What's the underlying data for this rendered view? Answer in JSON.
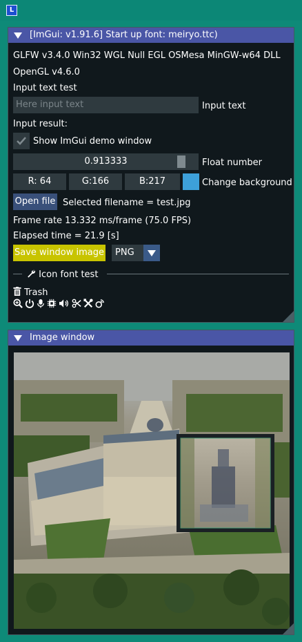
{
  "window": {
    "app_icon_letter": "L"
  },
  "main_panel": {
    "title": "[ImGui: v1.91.6] Start up font: meiryo.ttc)",
    "info_line1": "GLFW v3.4.0 Win32 WGL Null EGL OSMesa MinGW-w64 DLL",
    "info_line2": "OpenGL v4.6.0",
    "input_label": "Input text test",
    "input_placeholder": "Here input text",
    "input_side_label": "Input text",
    "input_result_label": "Input result:",
    "checkbox_label": "Show ImGui demo window",
    "checkbox_checked": true,
    "float_value": "0.913333",
    "float_label": "Float number",
    "float_fraction": 0.913333,
    "rgb": {
      "r": "R: 64",
      "g": "G:166",
      "b": "B:217"
    },
    "bg_label": "Change background",
    "bg_color": "#3da0d9",
    "open_file_label": "Open file",
    "selected_filename": "Selected filename = test.jpg",
    "frame_rate": "Frame rate  13.332 ms/frame (75.0 FPS)",
    "elapsed": "Elapsed time = 21.9 [s]",
    "save_label": "Save window image",
    "format_value": "PNG",
    "icon_section_label": "Icon font test",
    "trash_label": "Trash",
    "icon_names": [
      "search-plus-icon",
      "power-icon",
      "microphone-icon",
      "microchip-icon",
      "volume-icon",
      "scissors-icon",
      "tools-icon",
      "settings-icon"
    ]
  },
  "image_panel": {
    "title": "Image window"
  },
  "colors": {
    "header": "#4a56a6",
    "panel_bg": "#10181c",
    "accent_yellow": "#c8c400",
    "button_blue": "#39507a"
  }
}
